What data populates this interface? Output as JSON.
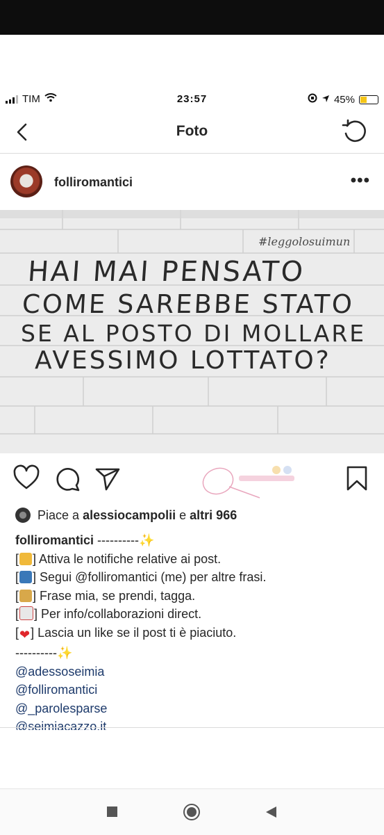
{
  "status_bar": {
    "carrier": "TIM",
    "time": "23:57",
    "battery": "45%",
    "battery_level": 0.45
  },
  "nav": {
    "title": "Foto",
    "back_icon": "chevron-left-icon",
    "reload_icon": "reload-icon"
  },
  "post": {
    "username": "folliromantici",
    "more_label": "•••",
    "image": {
      "hashtag": "#leggolosuimun",
      "lines": [
        "HAI MAI PENSATO",
        "COME SAREBBE STATO",
        "SE AL POSTO DI MOLLARE",
        "AVESSIMO LOTTATO?"
      ]
    },
    "actions": {
      "like_icon": "heart-icon",
      "comment_icon": "comment-icon",
      "share_icon": "send-icon",
      "save_icon": "bookmark-icon"
    },
    "likes": {
      "prefix": "Piace a",
      "user": "alessiocampolii",
      "middle": "e",
      "others": "altri 966"
    },
    "caption": {
      "username": "folliromantici",
      "dashes": "----------",
      "items": [
        {
          "icon": "bell-icon",
          "text": "Attiva le notifiche relative ai post."
        },
        {
          "icon": "people-icon",
          "text": "Segui @folliromantici (me) per altre frasi."
        },
        {
          "icon": "lock-icon",
          "text": "Frase mia, se prendi, tagga."
        },
        {
          "icon": "envelope-icon",
          "text": "Per info/collaborazioni direct."
        },
        {
          "icon": "heart-icon",
          "text": "Lascia un like se il post ti è piaciuto."
        }
      ],
      "dashes2": "----------",
      "mentions": [
        "@adessoseimia",
        "@folliromantici",
        "@_parolesparse",
        "@seimiacazzo.it"
      ]
    }
  },
  "colors": {
    "text": "#262626",
    "mention": "#1d3a6b",
    "divider": "#dbdbdb",
    "heart": "#e0262b",
    "battery": "#f5c518"
  }
}
